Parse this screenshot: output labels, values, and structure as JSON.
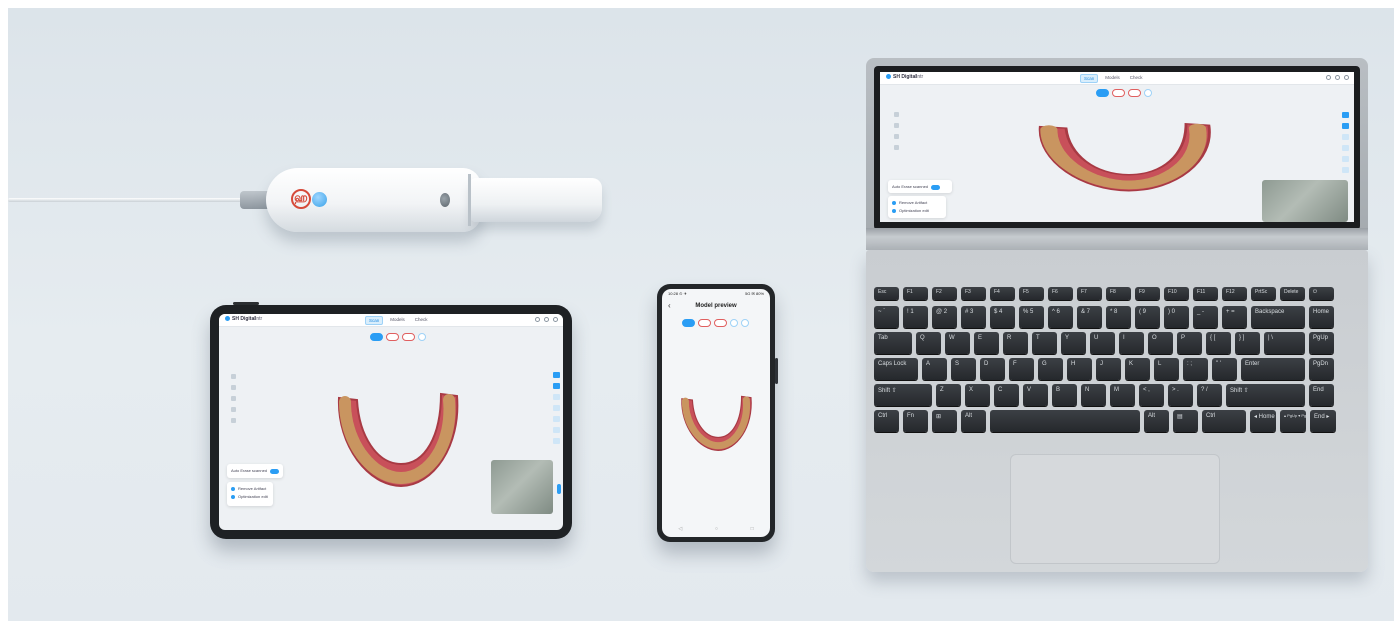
{
  "scanner": {
    "logo_glyph": "ஹ"
  },
  "tablet_app": {
    "brand": "SH Digital",
    "case": "Intr",
    "tabs": [
      "Scan",
      "Models",
      "Check"
    ],
    "panel_rows": [
      "Auto Erase scanned",
      "Remove Artifact",
      "Optimization edit"
    ]
  },
  "phone_app": {
    "status_time": "10:28 ⊙ ✈",
    "status_right": "5G ✉ 80%",
    "title": "Model preview",
    "back": "‹",
    "nav": [
      "◁",
      "○",
      "□"
    ]
  },
  "laptop_app": {
    "brand": "SH Digital",
    "case": "Intr",
    "tabs": [
      "Scan",
      "Models",
      "Check"
    ],
    "panel_rows": [
      "Auto Erase scanned",
      "Remove Artifact",
      "Optimization edit"
    ]
  },
  "keyboard": {
    "fn_row": [
      "Esc",
      "F1",
      "F2",
      "F3",
      "F4",
      "F5",
      "F6",
      "F7",
      "F8",
      "F9",
      "F10",
      "F11",
      "F12",
      "PrtSc",
      "Delete",
      "⏻"
    ],
    "num_row": [
      "~ `",
      "! 1",
      "@ 2",
      "# 3",
      "$ 4",
      "% 5",
      "^ 6",
      "& 7",
      "* 8",
      "( 9",
      ") 0",
      "_ -",
      "+ =",
      "Backspace",
      "Home"
    ],
    "tab_row": [
      "Tab",
      "Q",
      "W",
      "E",
      "R",
      "T",
      "Y",
      "U",
      "I",
      "O",
      "P",
      "{ [",
      "} ]",
      "| \\",
      "PgUp"
    ],
    "caps_row": [
      "Caps Lock",
      "A",
      "S",
      "D",
      "F",
      "G",
      "H",
      "J",
      "K",
      "L",
      ": ;",
      "\" '",
      "Enter",
      "PgDn"
    ],
    "shift_row": [
      "Shift ⇧",
      "Z",
      "X",
      "C",
      "V",
      "B",
      "N",
      "M",
      "< ,",
      "> .",
      "? /",
      "Shift ⇧",
      "End"
    ],
    "ctrl_row": [
      "Ctrl",
      "Fn",
      "⊞",
      "Alt",
      "",
      "Alt",
      "▤",
      "Ctrl",
      "◂ Home",
      "▴ PgUp ▾ PgDn",
      "End ▸"
    ]
  }
}
